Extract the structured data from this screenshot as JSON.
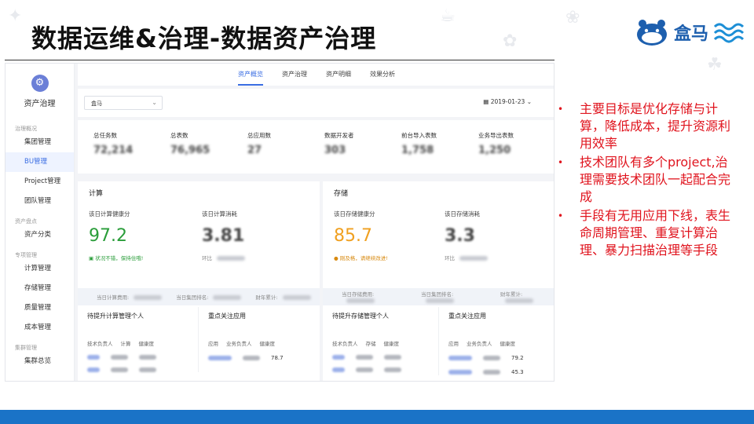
{
  "slide": {
    "title": "数据运维&治理-数据资产治理",
    "logo_text": "盒马"
  },
  "app": {
    "module_name": "资产治理",
    "nav": {
      "sections": [
        {
          "label": "治理概况",
          "items": [
            "集团管理",
            "BU管理",
            "Project管理",
            "团队管理"
          ]
        },
        {
          "label": "资产盘点",
          "items": [
            "资产分类"
          ]
        },
        {
          "label": "专项管理",
          "items": [
            "计算管理",
            "存储管理",
            "质量管理",
            "成本管理"
          ]
        },
        {
          "label": "集群管理",
          "items": [
            "集群总览"
          ]
        }
      ],
      "active_item": "BU管理"
    },
    "tabs": [
      "资产概览",
      "资产治理",
      "资产明细",
      "效果分析"
    ],
    "active_tab": "资产概览",
    "filter": {
      "select_value": "盒马",
      "date": "2019-01-23"
    },
    "stats": [
      {
        "label": "总任务数",
        "value": "72,214"
      },
      {
        "label": "总表数",
        "value": "76,965"
      },
      {
        "label": "总应用数",
        "value": "27"
      },
      {
        "label": "数据开发者",
        "value": "303"
      },
      {
        "label": "前台导入表数",
        "value": "1,758"
      },
      {
        "label": "业务导出表数",
        "value": "1,250"
      }
    ],
    "compute": {
      "title": "计算",
      "health_label": "该日计算健康分",
      "health_value": "97.2",
      "health_note": "状况不错，保持住哦!",
      "cost_label": "该日计算消耗",
      "cost_value": "3.81",
      "compare_label": "环比",
      "summary": [
        "当日计算费用:",
        "当日集团排名:",
        "财年累计:"
      ],
      "list_left_title": "待提升计算管理个人",
      "list_left_cols": [
        "技术负责人",
        "计算",
        "健康度"
      ],
      "list_right_title": "重点关注应用",
      "list_right_cols": [
        "应用",
        "业务负责人",
        "健康度"
      ],
      "list_right_values": [
        "78.7"
      ]
    },
    "storage": {
      "title": "存储",
      "health_label": "该日存储健康分",
      "health_value": "85.7",
      "health_note": "刚及格，请继续改进!",
      "cost_label": "该日存储消耗",
      "cost_value": "3.3",
      "compare_label": "环比",
      "summary": [
        "当日存储费用:",
        "当日集团排名:",
        "财年累计:"
      ],
      "list_left_title": "待提升存储管理个人",
      "list_left_cols": [
        "技术负责人",
        "存储",
        "健康度"
      ],
      "list_right_title": "重点关注应用",
      "list_right_cols": [
        "应用",
        "业务负责人",
        "健康度"
      ],
      "list_right_values": [
        "79.2",
        "45.3"
      ]
    }
  },
  "bullets": [
    "主要目标是优化存储与计算，降低成本，提升资源利用效率",
    "技术团队有多个project,治理需要技术团队一起配合完成",
    "手段有无用应用下线，表生命周期管理、重复计算治理、暴力扫描治理等手段"
  ],
  "colors": {
    "bullet_red": "#e0141e",
    "accent_blue": "#3b6ee3",
    "good_green": "#2a9d3a",
    "warn_orange": "#f0a020",
    "footer_blue": "#1a73c7"
  }
}
